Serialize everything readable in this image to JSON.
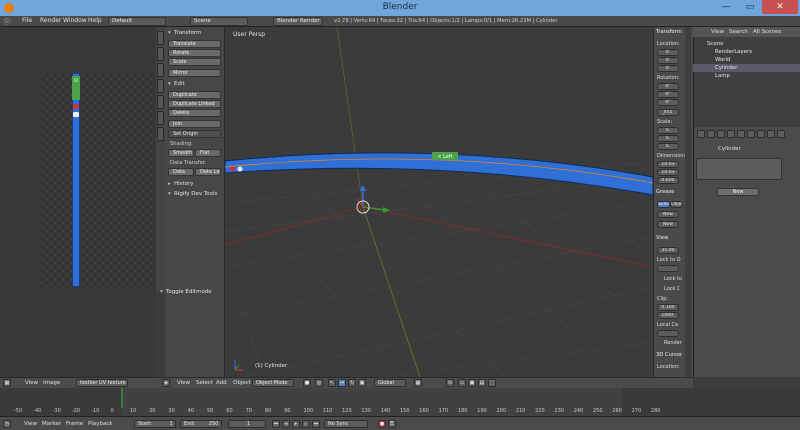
{
  "window": {
    "title": "Blender"
  },
  "menubar": {
    "menus": [
      "File",
      "Render",
      "Window",
      "Help"
    ],
    "layout": "Default",
    "scene": "Scene",
    "engine": "Blender Render",
    "info": "v2.78 | Verts:64 | Faces:32 | Tris:64 | Objects:1/2 | Lamps:0/1 | Mem:26.23M | Cylinder"
  },
  "toolshelf": {
    "transform_head": "Transform",
    "transform_buttons": [
      "Translate",
      "Rotate",
      "Scale",
      "Mirror"
    ],
    "edit_head": "Edit",
    "edit_buttons": [
      "Duplicate",
      "Duplicate Linked",
      "Delete",
      "Join",
      "Set Origin"
    ],
    "shading_label": "Shading:",
    "shading_smooth": "Smooth",
    "shading_flat": "Flat",
    "datatransfer_label": "Data Transfer:",
    "data_btn": "Data",
    "datalay_btn": "Data Lay",
    "history_head": "History",
    "rigify_head": "Rigify Dev Tools",
    "toggle_editmode": "Toggle Editmode"
  },
  "uv_label": "U",
  "viewport": {
    "view_name": "User Persp",
    "object_label": "(1) Cylinder",
    "floating_tab": "< Left"
  },
  "npanel": {
    "transform_head": "Transform",
    "location": "Location:",
    "loc_vals": [
      "0.",
      "0.",
      "0."
    ],
    "rotation": "Rotation:",
    "rot_vals": [
      "0°",
      "0°",
      "0°"
    ],
    "rot_mode": "XYZ Euler",
    "scale": "Scale:",
    "scale_vals": [
      "5.",
      "5.",
      "5."
    ],
    "dimensions": "Dimensions:",
    "dim_vals": [
      "10.63",
      "10.63",
      "0.600"
    ],
    "grease_head": "Grease",
    "scene_btn": "Scene",
    "object_btn": "Object",
    "new_btn": "New",
    "new_layer_btn": "New Layer",
    "view_head": "View",
    "lens_val": "35.00",
    "lock_to": "Lock to O",
    "lock_to_cursor": "Lock to",
    "lock_cam": "Lock C",
    "clip": "Clip:",
    "clip_vals": [
      "0.100",
      "1000."
    ],
    "local_cam": "Local Ca",
    "render_label": "Render",
    "cursor_head": "3D Cursor",
    "cursor_location": "Location:"
  },
  "outliner": {
    "view": "View",
    "search": "Search",
    "all_scenes": "All Scenes",
    "rows": [
      "Scene",
      "RenderLayers",
      "World",
      "Cylinder",
      "Lamp"
    ]
  },
  "properties": {
    "object_name": "Cylinder",
    "new_btn": "New"
  },
  "uv_header": {
    "view": "View",
    "image": "Image",
    "image_name": "testker UV texture"
  },
  "vp_header": {
    "items": [
      "View",
      "Select",
      "Add",
      "Object"
    ],
    "mode": "Object Mode",
    "orientation": "Global"
  },
  "timeline": {
    "ticks": [
      "-50",
      "-40",
      "-30",
      "-20",
      "-10",
      "0",
      "10",
      "20",
      "30",
      "40",
      "50",
      "60",
      "70",
      "80",
      "90",
      "100",
      "110",
      "120",
      "130",
      "140",
      "150",
      "160",
      "170",
      "180",
      "190",
      "200",
      "210",
      "220",
      "230",
      "240",
      "250",
      "260",
      "270",
      "280"
    ],
    "header_items": [
      "View",
      "Marker",
      "Frame",
      "Playback"
    ],
    "start": "Start:",
    "start_val": "1",
    "end": "End:",
    "end_val": "250",
    "current": "1",
    "sync": "No Sync"
  }
}
